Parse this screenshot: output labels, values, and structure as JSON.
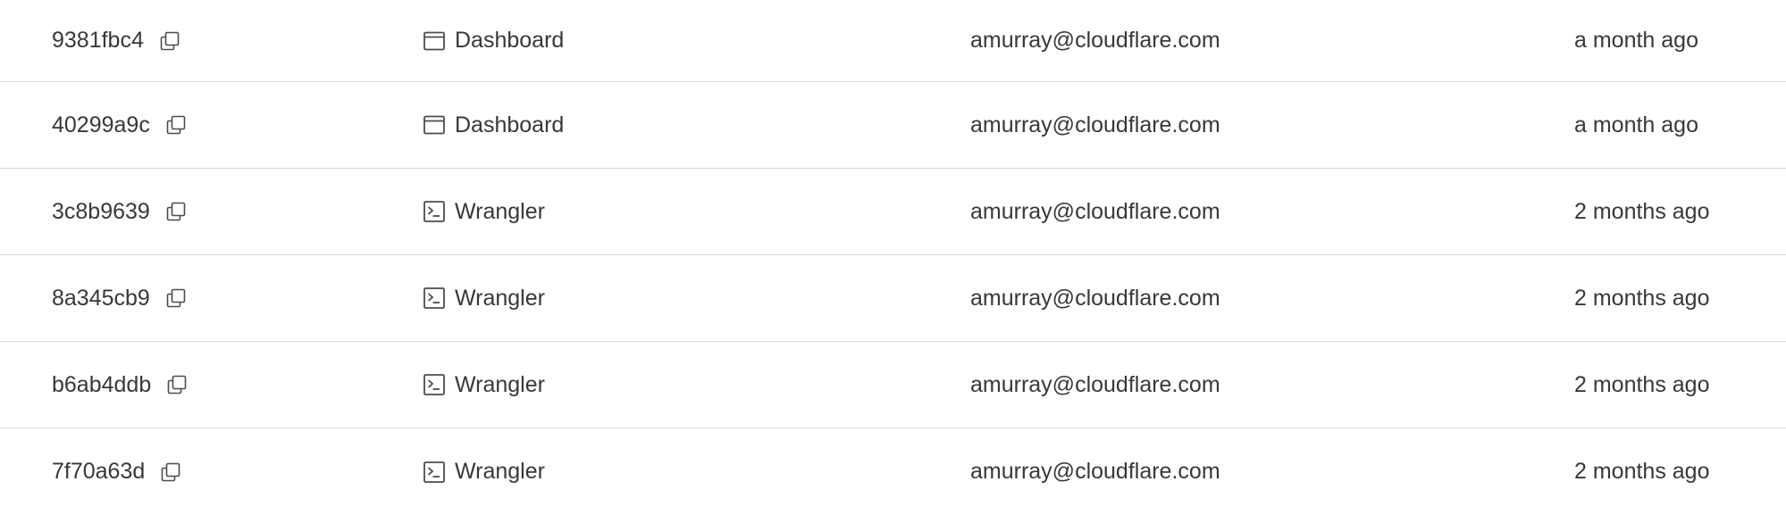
{
  "colors": {
    "text": "#36393a",
    "icon": "#4a4d4f",
    "divider": "#d9d9d9",
    "background": "#ffffff"
  },
  "deployments": [
    {
      "id": "9381fbc4",
      "source": "Dashboard",
      "source_icon": "browser-window-icon",
      "author": "amurray@cloudflare.com",
      "time": "a month ago"
    },
    {
      "id": "40299a9c",
      "source": "Dashboard",
      "source_icon": "browser-window-icon",
      "author": "amurray@cloudflare.com",
      "time": "a month ago"
    },
    {
      "id": "3c8b9639",
      "source": "Wrangler",
      "source_icon": "terminal-icon",
      "author": "amurray@cloudflare.com",
      "time": "2 months ago"
    },
    {
      "id": "8a345cb9",
      "source": "Wrangler",
      "source_icon": "terminal-icon",
      "author": "amurray@cloudflare.com",
      "time": "2 months ago"
    },
    {
      "id": "b6ab4ddb",
      "source": "Wrangler",
      "source_icon": "terminal-icon",
      "author": "amurray@cloudflare.com",
      "time": "2 months ago"
    },
    {
      "id": "7f70a63d",
      "source": "Wrangler",
      "source_icon": "terminal-icon",
      "author": "amurray@cloudflare.com",
      "time": "2 months ago"
    }
  ]
}
